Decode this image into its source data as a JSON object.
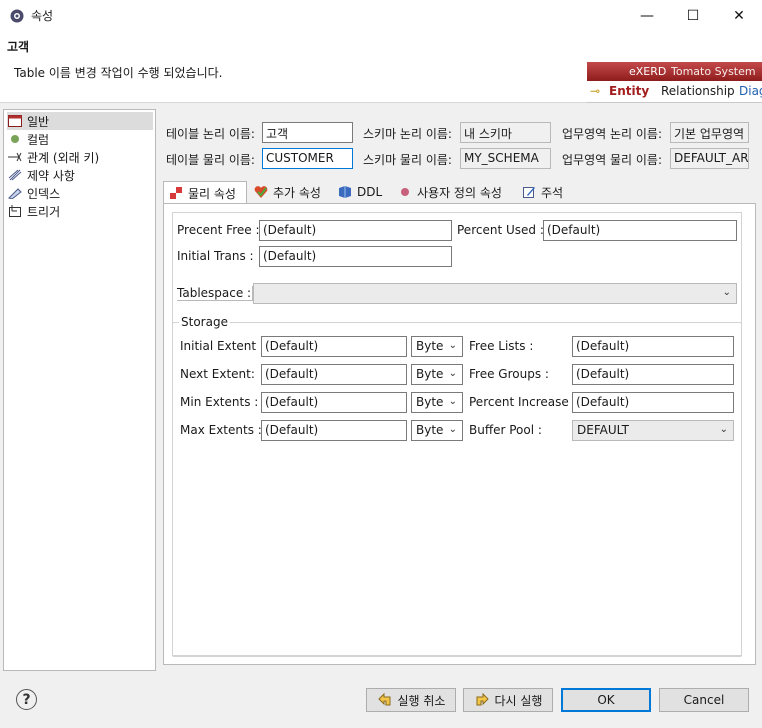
{
  "window": {
    "title": "속성",
    "minimize": "—",
    "maximize": "☐",
    "close": "✕"
  },
  "header": {
    "title": "고객",
    "message": "Table 이름 변경 작업이 수행 되었습니다."
  },
  "erd": {
    "brand": "eXERD",
    "company": "Tomato System",
    "tab_entity": "Entity",
    "tab_relationship": "Relationship",
    "tab_diag": "Diag"
  },
  "tree": {
    "items": [
      {
        "label": "일반",
        "icon": "table-icon"
      },
      {
        "label": "컬럼",
        "icon": "column-dot-icon"
      },
      {
        "label": "관계 (외래 키)",
        "icon": "relation-icon"
      },
      {
        "label": "제약 사항",
        "icon": "constraint-icon"
      },
      {
        "label": "인덱스",
        "icon": "index-icon"
      },
      {
        "label": "트리거",
        "icon": "trigger-icon"
      }
    ]
  },
  "general": {
    "logical_name_label": "테이블 논리 이름:",
    "logical_name_value": "고객",
    "physical_name_label": "테이블 물리 이름:",
    "physical_name_value": "CUSTOMER",
    "schema_logical_label": "스키마 논리 이름:",
    "schema_logical_value": "내 스키마",
    "schema_physical_label": "스키마 물리 이름:",
    "schema_physical_value": "MY_SCHEMA",
    "area_logical_label": "업무영역 논리 이름:",
    "area_logical_value": "기본 업무영역",
    "area_physical_label": "업무영역 물리 이름:",
    "area_physical_value": "DEFAULT_AREA"
  },
  "tabs": [
    {
      "label": "물리 속성",
      "icon": "physical-attr-icon"
    },
    {
      "label": "추가 속성",
      "icon": "extra-attr-icon"
    },
    {
      "label": "DDL",
      "icon": "ddl-icon"
    },
    {
      "label": "사용자 정의 속성",
      "icon": "user-attr-icon"
    },
    {
      "label": "주석",
      "icon": "comment-icon"
    }
  ],
  "physical": {
    "percent_free_label": "Precent Free :",
    "percent_free_value": "(Default)",
    "percent_used_label": "Percent Used :",
    "percent_used_value": "(Default)",
    "initial_trans_label": "Initial Trans :",
    "initial_trans_value": "(Default)",
    "tablespace_label": "Tablespace :",
    "tablespace_value": ""
  },
  "storage": {
    "title": "Storage",
    "initial_extent_label": "Initial Extent :",
    "initial_extent_value": "(Default)",
    "initial_extent_unit": "Byte",
    "next_extent_label": "Next Extent:",
    "next_extent_value": "(Default)",
    "next_extent_unit": "Byte",
    "min_extents_label": "Min Extents :",
    "min_extents_value": "(Default)",
    "min_extents_unit": "Byte",
    "max_extents_label": "Max Extents :",
    "max_extents_value": "(Default)",
    "max_extents_unit": "Byte",
    "free_lists_label": "Free Lists :",
    "free_lists_value": "(Default)",
    "free_groups_label": "Free Groups :",
    "free_groups_value": "(Default)",
    "percent_increase_label": "Percent Increase :",
    "percent_increase_value": "(Default)",
    "buffer_pool_label": "Buffer Pool :",
    "buffer_pool_value": "DEFAULT"
  },
  "buttons": {
    "undo": "실행 취소",
    "redo": "다시 실행",
    "ok": "OK",
    "cancel": "Cancel",
    "help": "?"
  }
}
